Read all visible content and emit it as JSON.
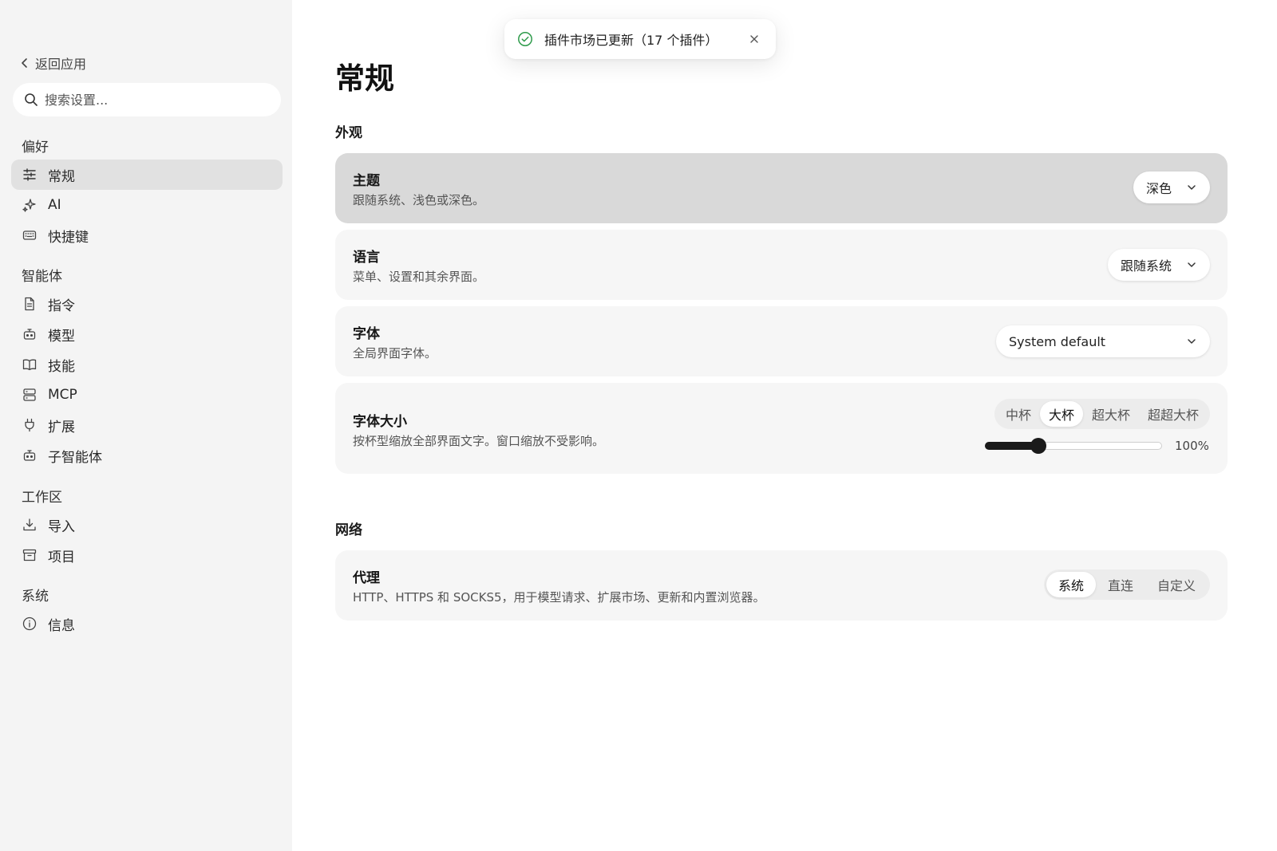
{
  "sidebar": {
    "back_label": "返回应用",
    "search_placeholder": "搜索设置...",
    "groups": [
      {
        "label": "偏好",
        "items": [
          {
            "label": "常规",
            "icon": "sliders-icon",
            "active": true
          },
          {
            "label": "AI",
            "icon": "sparkles-icon"
          },
          {
            "label": "快捷键",
            "icon": "keyboard-icon"
          }
        ]
      },
      {
        "label": "智能体",
        "items": [
          {
            "label": "指令",
            "icon": "document-icon"
          },
          {
            "label": "模型",
            "icon": "bot-icon"
          },
          {
            "label": "技能",
            "icon": "book-icon"
          },
          {
            "label": "MCP",
            "icon": "server-icon"
          },
          {
            "label": "扩展",
            "icon": "plug-icon"
          },
          {
            "label": "子智能体",
            "icon": "bot-icon"
          }
        ]
      },
      {
        "label": "工作区",
        "items": [
          {
            "label": "导入",
            "icon": "download-icon"
          },
          {
            "label": "项目",
            "icon": "archive-icon"
          }
        ]
      },
      {
        "label": "系统",
        "items": [
          {
            "label": "信息",
            "icon": "info-icon"
          }
        ]
      }
    ]
  },
  "main": {
    "title": "常规",
    "sections": {
      "appearance": {
        "title": "外观",
        "theme": {
          "title": "主题",
          "desc": "跟随系统、浅色或深色。",
          "value": "深色"
        },
        "language": {
          "title": "语言",
          "desc": "菜单、设置和其余界面。",
          "value": "跟随系统"
        },
        "font": {
          "title": "字体",
          "desc": "全局界面字体。",
          "value": "System default"
        },
        "font_size": {
          "title": "字体大小",
          "desc": "按杯型缩放全部界面文字。窗口缩放不受影响。",
          "options": [
            "中杯",
            "大杯",
            "超大杯",
            "超超大杯"
          ],
          "selected": "大杯",
          "slider_fraction": 0.3,
          "slider_label": "100%"
        }
      },
      "network": {
        "title": "网络",
        "proxy": {
          "title": "代理",
          "desc": "HTTP、HTTPS 和 SOCKS5，用于模型请求、扩展市场、更新和内置浏览器。",
          "options": [
            "系统",
            "直连",
            "自定义"
          ],
          "selected": "系统"
        }
      }
    }
  },
  "toast": {
    "text": "插件市场已更新（17 个插件）",
    "icon": "check-circle-icon",
    "success_color": "#2e9b4b"
  }
}
